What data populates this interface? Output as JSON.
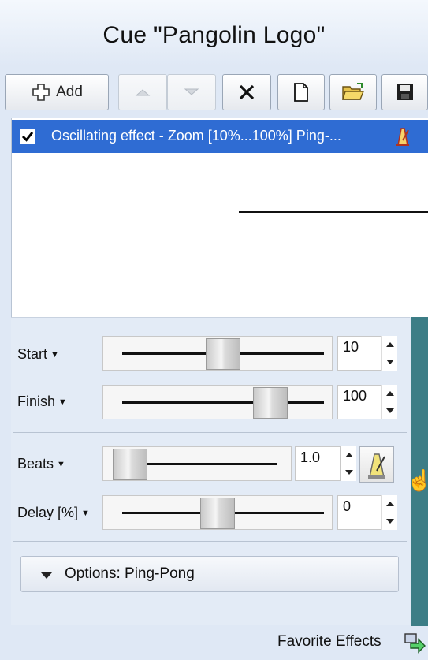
{
  "title": "Cue \"Pangolin Logo\"",
  "toolbar": {
    "add_label": "Add",
    "buttons": [
      "add-button",
      "move-up-button",
      "move-down-button",
      "delete-button",
      "new-button",
      "open-button",
      "save-button"
    ]
  },
  "effect_list": {
    "items": [
      {
        "label": "Oscillating effect - Zoom [10%...100%] Ping-...",
        "checked": true,
        "selected": true
      }
    ]
  },
  "params": {
    "start": {
      "label": "Start",
      "value": "10",
      "level": 0.53
    },
    "finish": {
      "label": "Finish",
      "value": "100",
      "level": 0.8
    },
    "beats": {
      "label": "Beats",
      "value": "1.0",
      "level": 0.0
    },
    "delay": {
      "label": "Delay [%]",
      "value": "0",
      "level": 0.5
    }
  },
  "options": {
    "label": "Options: Ping-Pong"
  },
  "footer": {
    "label": "Favorite Effects"
  },
  "colors": {
    "selection": "#2f6cd3",
    "scrollbar": "#3c7d86",
    "panel": "#e3ebf6"
  }
}
